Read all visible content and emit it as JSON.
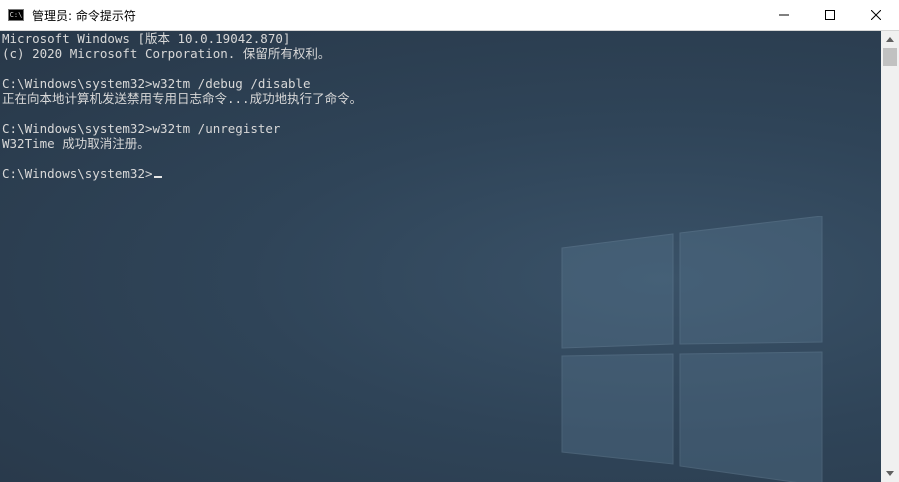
{
  "window": {
    "title": "管理员: 命令提示符",
    "app_icon_text": "C:\\"
  },
  "terminal": {
    "lines": [
      "Microsoft Windows [版本 10.0.19042.870]",
      "(c) 2020 Microsoft Corporation. 保留所有权利。",
      "",
      "C:\\Windows\\system32>w32tm /debug /disable",
      "正在向本地计算机发送禁用专用日志命令...成功地执行了命令。",
      "",
      "C:\\Windows\\system32>w32tm /unregister",
      "W32Time 成功取消注册。",
      ""
    ],
    "prompt": "C:\\Windows\\system32>"
  },
  "icons": [
    "cmd-app-icon",
    "minimize-icon",
    "maximize-icon",
    "close-icon",
    "scroll-up-arrow-icon",
    "scroll-down-arrow-icon"
  ]
}
